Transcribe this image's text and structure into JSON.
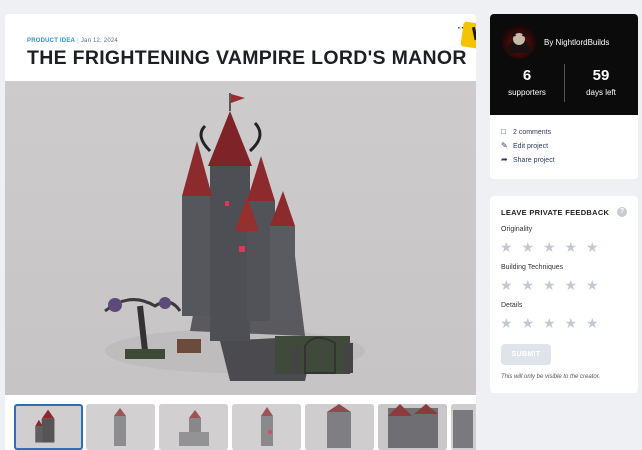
{
  "project": {
    "category": "PRODUCT IDEA",
    "date": "Jan 12, 2024",
    "title": "THE FRIGHTENING VAMPIRE LORD'S MANOR",
    "menu_icon": "more-dots-icon"
  },
  "creator": {
    "by_label": "By NightlordBuilds",
    "supporters_count": "6",
    "supporters_label": "supporters",
    "days_left_count": "59",
    "days_left_label": "days left"
  },
  "actions": [
    {
      "icon": "comment-icon",
      "label": "2 comments"
    },
    {
      "icon": "edit-icon",
      "label": "Edit project"
    },
    {
      "icon": "share-icon",
      "label": "Share project"
    }
  ],
  "feedback": {
    "title": "LEAVE PRIVATE FEEDBACK",
    "help_icon": "help-icon",
    "criteria": [
      {
        "label": "Originality",
        "rating": 0,
        "max": 5
      },
      {
        "label": "Building Techniques",
        "rating": 0,
        "max": 5
      },
      {
        "label": "Details",
        "rating": 0,
        "max": 5
      }
    ],
    "submit_label": "SUBMIT",
    "note": "This will only be visible to the creator."
  },
  "gallery": {
    "count": 7,
    "active_index": 0
  },
  "colors": {
    "accent": "#2f8fd8",
    "badge": "#f5c400",
    "roof_red": "#8c2a2e",
    "star_empty": "#c3c9d2",
    "dark_panel": "#0b0b0b"
  }
}
